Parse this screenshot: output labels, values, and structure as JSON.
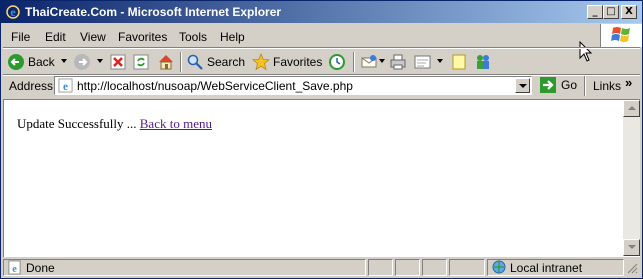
{
  "window": {
    "title": "ThaiCreate.Com - Microsoft Internet Explorer",
    "controls": {
      "minimize": "_",
      "maximize": "□",
      "close": "X"
    }
  },
  "menubar": {
    "items": [
      {
        "label": "File"
      },
      {
        "label": "Edit"
      },
      {
        "label": "View"
      },
      {
        "label": "Favorites"
      },
      {
        "label": "Tools"
      },
      {
        "label": "Help"
      }
    ]
  },
  "toolbar": {
    "back_label": "Back",
    "search_label": "Search",
    "favorites_label": "Favorites"
  },
  "addressbar": {
    "label": "Address",
    "url": "http://localhost/nusoap/WebServiceClient_Save.php",
    "go_label": "Go",
    "links_label": "Links",
    "links_chevron": "»"
  },
  "page": {
    "message": "Update Successfully ... ",
    "link_text": "Back to menu"
  },
  "statusbar": {
    "status": "Done",
    "zone": "Local intranet"
  },
  "colors": {
    "titlebar_start": "#0a246a",
    "titlebar_end": "#a6caf0",
    "chrome": "#d4d0c8",
    "visited_link": "#551a8b",
    "go_green": "#2e9a2e"
  }
}
